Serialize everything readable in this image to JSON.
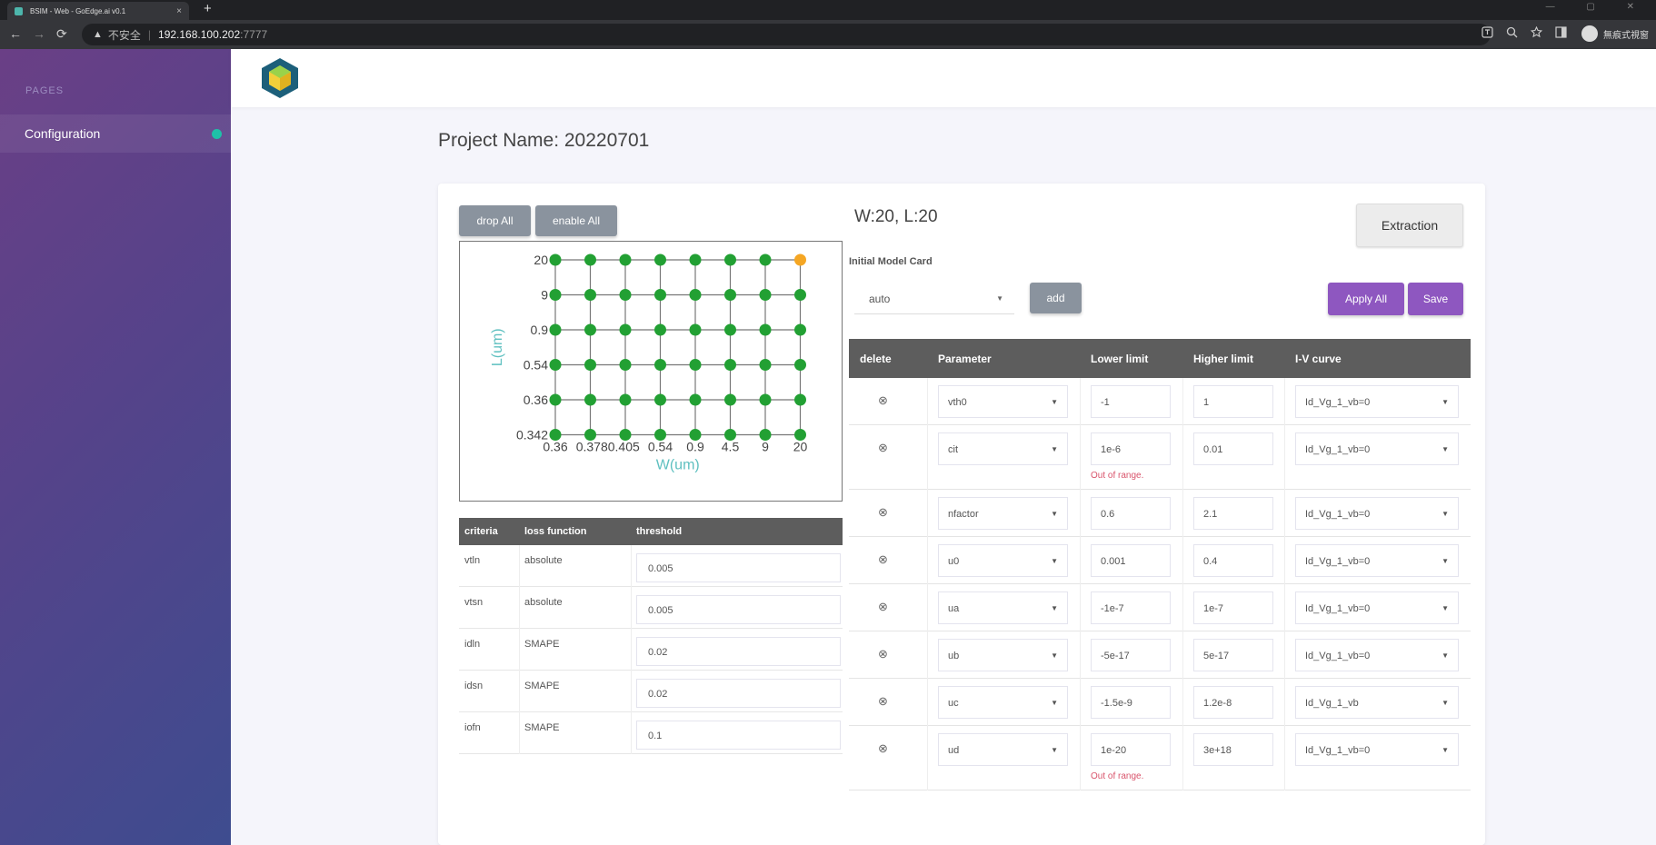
{
  "browser": {
    "tab_title": "BSIM - Web - GoEdge.ai v0.1",
    "tab_close": "×",
    "new_tab": "+",
    "window_controls": "— ▢ ✕",
    "back": "←",
    "forward": "→",
    "reload": "⟳",
    "warning_icon": "▲",
    "insecure_label": "不安全",
    "separator": "|",
    "url_host": "192.168.100.202",
    "url_port": ":7777",
    "toolbar_icons": [
      "translate-icon",
      "zoom-icon",
      "star-icon",
      "sidebar-icon"
    ],
    "profile_name": "無痕式視窗"
  },
  "sidebar": {
    "section_label": "PAGES",
    "items": [
      {
        "label": "Configuration",
        "active": true
      }
    ]
  },
  "project": {
    "title": "Project Name: 20220701"
  },
  "grid_controls": {
    "drop_all": "drop All",
    "enable_all": "enable All"
  },
  "chart_data": {
    "type": "scatter",
    "title": "",
    "xlabel": "W(um)",
    "ylabel": "L(um)",
    "x_categories": [
      "0.36",
      "0.378",
      "0.405",
      "0.54",
      "0.9",
      "4.5",
      "9",
      "20"
    ],
    "x_tick_labels": [
      "0.36",
      "0.3780.405",
      "0.54",
      "0.9",
      "4.5",
      "9",
      "20"
    ],
    "y_categories": [
      "0.342",
      "0.36",
      "0.54",
      "0.9",
      "9",
      "20"
    ],
    "grid": true,
    "point_color_default": "#22a033",
    "point_color_selected": "#f5a623",
    "selected_point": {
      "W": "20",
      "L": "20"
    }
  },
  "criteria": {
    "headers": {
      "criteria": "criteria",
      "loss": "loss function",
      "threshold": "threshold"
    },
    "rows": [
      {
        "name": "vtln",
        "loss": "absolute",
        "threshold": "0.005"
      },
      {
        "name": "vtsn",
        "loss": "absolute",
        "threshold": "0.005"
      },
      {
        "name": "idln",
        "loss": "SMAPE",
        "threshold": "0.02"
      },
      {
        "name": "idsn",
        "loss": "SMAPE",
        "threshold": "0.02"
      },
      {
        "name": "iofn",
        "loss": "SMAPE",
        "threshold": "0.1"
      }
    ]
  },
  "model": {
    "wl_label": "W:20, L:20",
    "extraction": "Extraction",
    "initial_model_card_label": "Initial Model Card",
    "initial_model_card_value": "auto",
    "add": "add",
    "apply_all": "Apply All",
    "save": "Save"
  },
  "params": {
    "headers": {
      "delete": "delete",
      "parameter": "Parameter",
      "lower": "Lower limit",
      "higher": "Higher limit",
      "iv": "I-V curve"
    },
    "delete_icon": "⊗",
    "error_text": "Out of range.",
    "rows": [
      {
        "name": "vth0",
        "lower": "-1",
        "higher": "1",
        "iv": "Id_Vg_1_vb=0",
        "error": false
      },
      {
        "name": "cit",
        "lower": "1e-6",
        "higher": "0.01",
        "iv": "Id_Vg_1_vb=0",
        "error": true
      },
      {
        "name": "nfactor",
        "lower": "0.6",
        "higher": "2.1",
        "iv": "Id_Vg_1_vb=0",
        "error": false
      },
      {
        "name": "u0",
        "lower": "0.001",
        "higher": "0.4",
        "iv": "Id_Vg_1_vb=0",
        "error": false
      },
      {
        "name": "ua",
        "lower": "-1e-7",
        "higher": "1e-7",
        "iv": "Id_Vg_1_vb=0",
        "error": false
      },
      {
        "name": "ub",
        "lower": "-5e-17",
        "higher": "5e-17",
        "iv": "Id_Vg_1_vb=0",
        "error": false
      },
      {
        "name": "uc",
        "lower": "-1.5e-9",
        "higher": "1.2e-8",
        "iv": "Id_Vg_1_vb",
        "error": false
      },
      {
        "name": "ud",
        "lower": "1e-20",
        "higher": "3e+18",
        "iv": "Id_Vg_1_vb=0",
        "error": true
      }
    ]
  }
}
